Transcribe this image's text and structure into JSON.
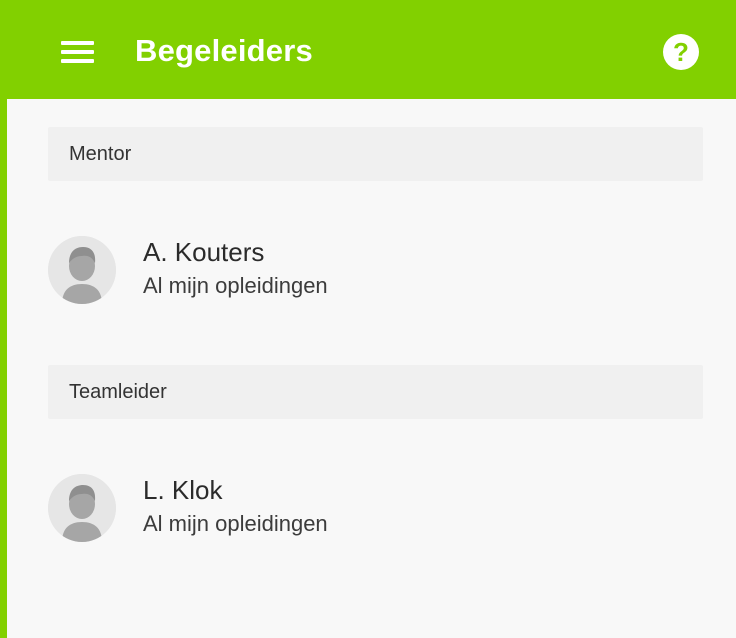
{
  "header": {
    "title": "Begeleiders",
    "menu_icon": "hamburger-menu-icon",
    "help_icon": "help-icon",
    "help_glyph": "?",
    "accent_color": "#82d000"
  },
  "sections": [
    {
      "label": "Mentor",
      "person": {
        "name": "A. Kouters",
        "subtitle": "Al mijn opleidingen",
        "avatar_icon": "user-avatar-icon"
      }
    },
    {
      "label": "Teamleider",
      "person": {
        "name": "L. Klok",
        "subtitle": "Al mijn opleidingen",
        "avatar_icon": "user-avatar-icon"
      }
    }
  ]
}
